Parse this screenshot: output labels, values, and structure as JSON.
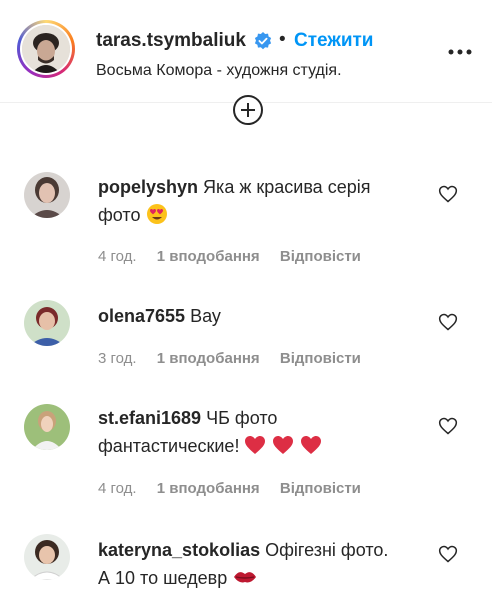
{
  "header": {
    "username": "taras.tsymbaliuk",
    "follow_label": "Стежити",
    "separator": "•",
    "bio": "Восьма Комора - художня студія."
  },
  "comments": [
    {
      "username": "popelyshyn",
      "text_line1": "Яка ж красива серія",
      "text_line2": "фото",
      "emoji": "smiling-face-with-heart-eyes",
      "time": "4 год.",
      "likes": "1 вподобання",
      "reply": "Відповісти"
    },
    {
      "username": "olena7655",
      "text_line1": "Вау",
      "time": "3 год.",
      "likes": "1 вподобання",
      "reply": "Відповісти"
    },
    {
      "username": "st.efani1689",
      "text_line1": "ЧБ фото",
      "text_line2": "фантастические!",
      "emoji": "three-red-hearts",
      "time": "4 год.",
      "likes": "1 вподобання",
      "reply": "Відповісти"
    },
    {
      "username": "kateryna_stokolias",
      "text_line1": "Офігезні фото.",
      "text_line2": "А 10 то шедевр",
      "emoji": "lips",
      "time": "",
      "likes": "",
      "reply": ""
    }
  ],
  "colors": {
    "accent": "#0095f6",
    "text": "#262626",
    "muted": "#8e8e8e",
    "heart": "#e0245e"
  }
}
